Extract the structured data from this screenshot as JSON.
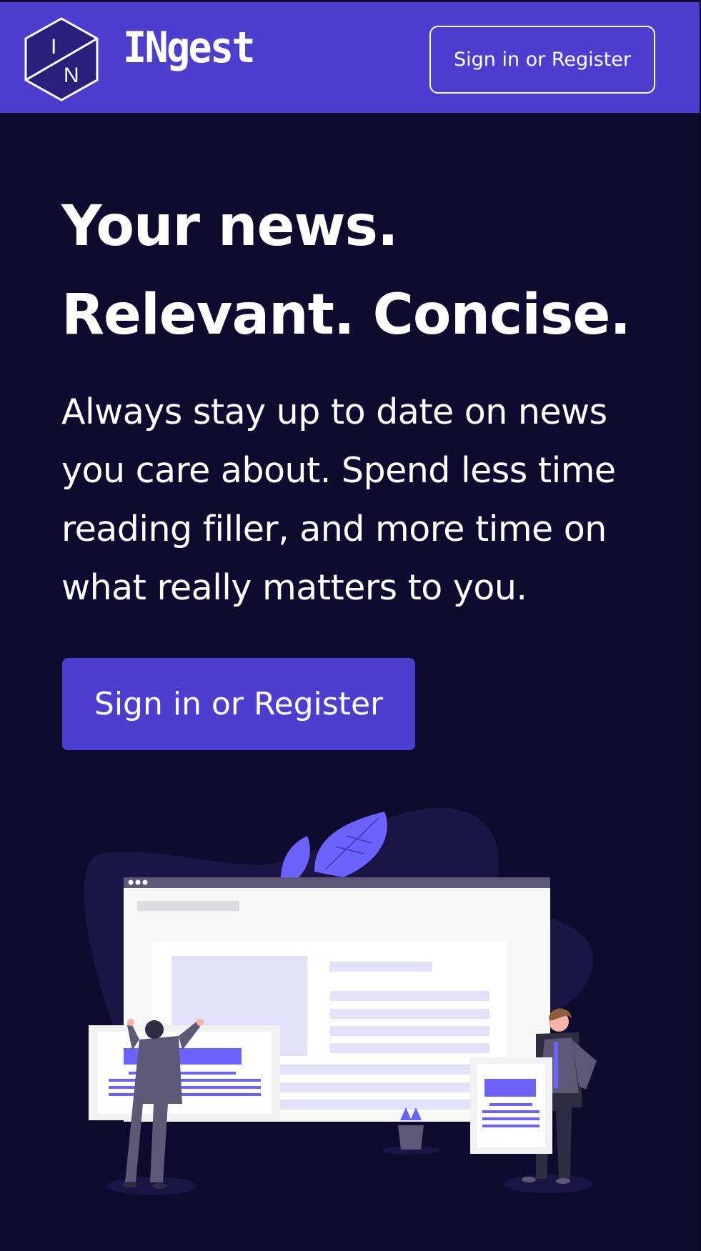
{
  "header": {
    "logo_text": "INgest",
    "logo_mark_letters": [
      "I",
      "N"
    ],
    "nav_button_label": "Sign in or Register"
  },
  "hero": {
    "headline": "Your news. Relevant. Concise.",
    "subtext": "Always stay up to date on news you care about. Spend less time reading filler, and more time on what really matters to you.",
    "cta_label": "Sign in or Register"
  },
  "illustration": {
    "icon": "news-reading-illustration"
  },
  "colors": {
    "background": "#0f0b2e",
    "accent": "#4c3fcf",
    "illustration_accent": "#6c63ff",
    "text": "#ffffff"
  }
}
